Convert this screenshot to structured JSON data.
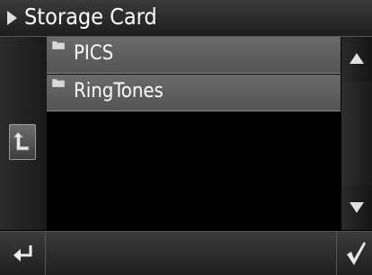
{
  "header": {
    "title": "Storage Card"
  },
  "file_list": {
    "items": [
      {
        "label": "PICS",
        "icon": "folder-icon"
      },
      {
        "label": "RingTones",
        "icon": "folder-icon"
      }
    ]
  },
  "icons": {
    "title": "play-arrow-icon",
    "parent": "up-level-icon",
    "scroll_up": "triangle-up-icon",
    "scroll_down": "triangle-down-icon",
    "back": "return-arrow-icon",
    "confirm": "checkmark-icon"
  }
}
